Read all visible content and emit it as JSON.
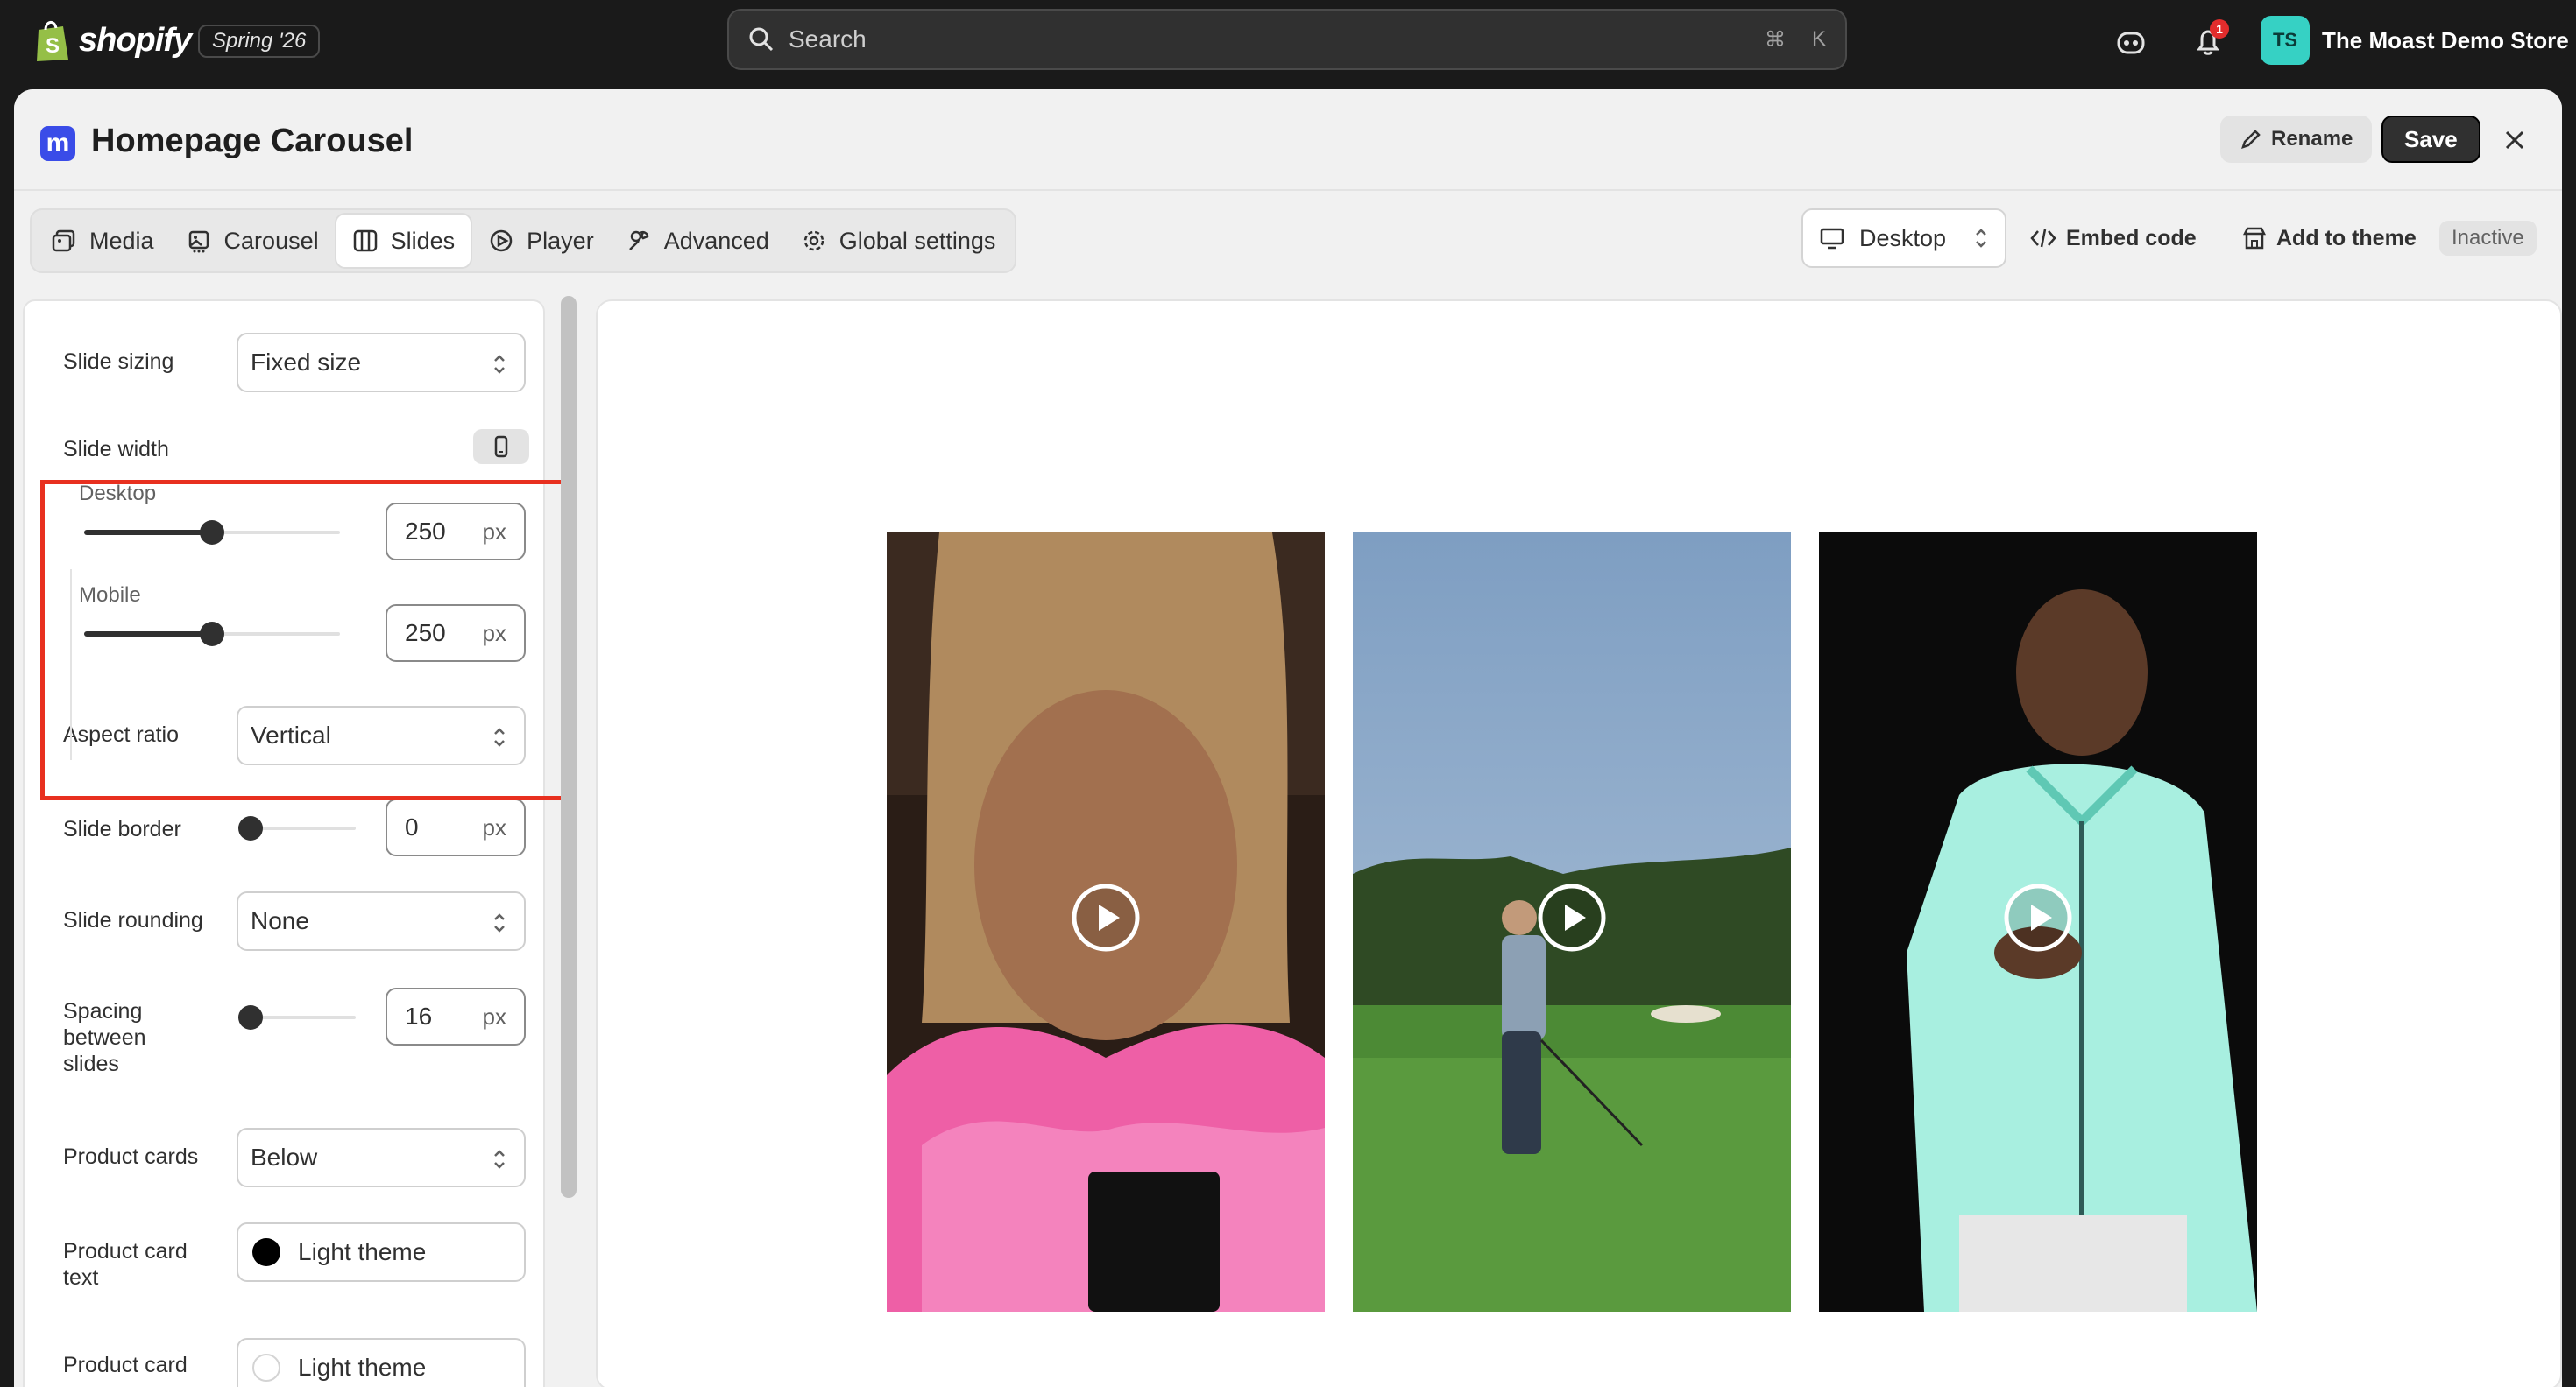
{
  "topbar": {
    "brand": "shopify",
    "edition": "Spring '26",
    "search_placeholder": "Search",
    "search_shortcut_cmd": "⌘",
    "search_shortcut_key": "K",
    "notification_count": "1",
    "store_initials": "TS",
    "store_name": "The Moast Demo Store"
  },
  "modal": {
    "title": "Homepage Carousel",
    "app_icon_letter": "m",
    "rename_label": "Rename",
    "save_label": "Save"
  },
  "tabs": [
    {
      "label": "Media",
      "icon": "media-icon"
    },
    {
      "label": "Carousel",
      "icon": "carousel-icon"
    },
    {
      "label": "Slides",
      "icon": "slides-icon",
      "active": true
    },
    {
      "label": "Player",
      "icon": "play-circle-icon"
    },
    {
      "label": "Advanced",
      "icon": "wrench-icon"
    },
    {
      "label": "Global settings",
      "icon": "gear-icon"
    }
  ],
  "toolbar": {
    "device": "Desktop",
    "embed_label": "Embed code",
    "add_theme_label": "Add to theme",
    "status": "Inactive"
  },
  "settings": {
    "slide_sizing": {
      "label": "Slide sizing",
      "value": "Fixed size"
    },
    "slide_width": {
      "label": "Slide width",
      "desktop": {
        "label": "Desktop",
        "value": "250",
        "unit": "px",
        "level": 0.5
      },
      "mobile": {
        "label": "Mobile",
        "value": "250",
        "unit": "px",
        "level": 0.5
      }
    },
    "aspect_ratio": {
      "label": "Aspect ratio",
      "value": "Vertical"
    },
    "slide_border": {
      "label": "Slide border",
      "value": "0",
      "unit": "px",
      "level": 0.0
    },
    "slide_rounding": {
      "label": "Slide rounding",
      "value": "None"
    },
    "spacing": {
      "label_1": "Spacing",
      "label_2": "between",
      "label_3": "slides",
      "value": "16",
      "unit": "px",
      "level": 0.06
    },
    "product_cards": {
      "label": "Product cards",
      "value": "Below"
    },
    "product_card_text": {
      "label_1": "Product card",
      "label_2": "text",
      "value": "Light theme",
      "swatch": "#000000"
    },
    "product_card_bg": {
      "label_1": "Product card",
      "value": "Light theme",
      "swatch": "#ffffff"
    }
  },
  "colors": {
    "accent_red": "#e8301f",
    "brand_blue": "#3a4ce8",
    "avatar_teal": "#36d1c4"
  }
}
